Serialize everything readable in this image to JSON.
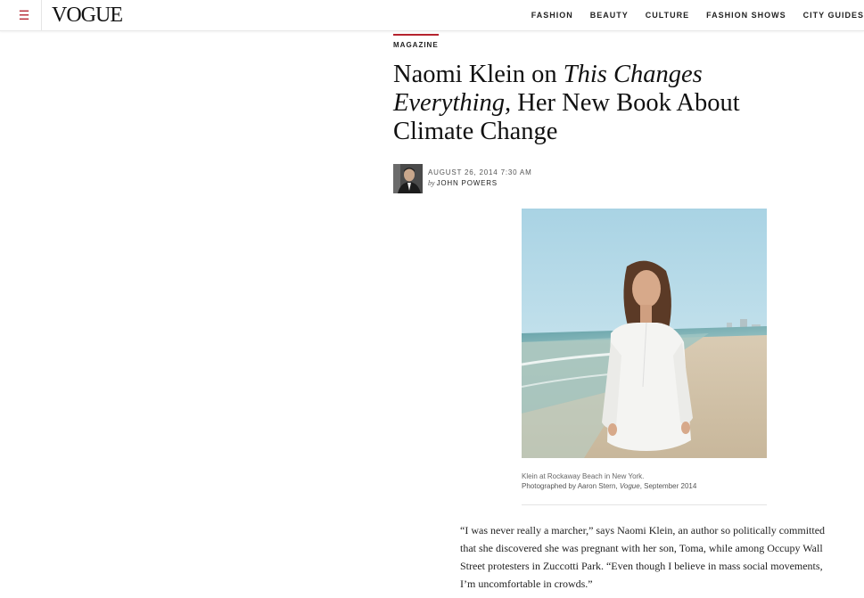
{
  "header": {
    "menu_icon": "hamburger-icon",
    "logo": "VOGUE",
    "nav": [
      "FASHION",
      "BEAUTY",
      "CULTURE",
      "FASHION SHOWS",
      "CITY GUIDES"
    ]
  },
  "article": {
    "section": "MAGAZINE",
    "headline_part1": "Naomi Klein on ",
    "headline_italic": "This Changes Everything,",
    "headline_part2": " Her New Book About Climate Change",
    "date": "AUGUST 26, 2014 7:30 AM",
    "by": "by",
    "author": "JOHN POWERS",
    "caption": "Klein at Rockaway Beach in New York.",
    "credit_prefix": "Photographed by Aaron Stern, ",
    "credit_mag": "Vogue",
    "credit_suffix": ", September 2014",
    "body": "“I was never really a marcher,” says Naomi Klein, an author so politically committed that she discovered she was pregnant with her son, Toma, while among Occupy Wall Street protesters in Zuccotti Park. “Even though I believe in mass social movements, I’m uncomfortable in crowds.”"
  },
  "colors": {
    "accent": "#b5232e"
  }
}
